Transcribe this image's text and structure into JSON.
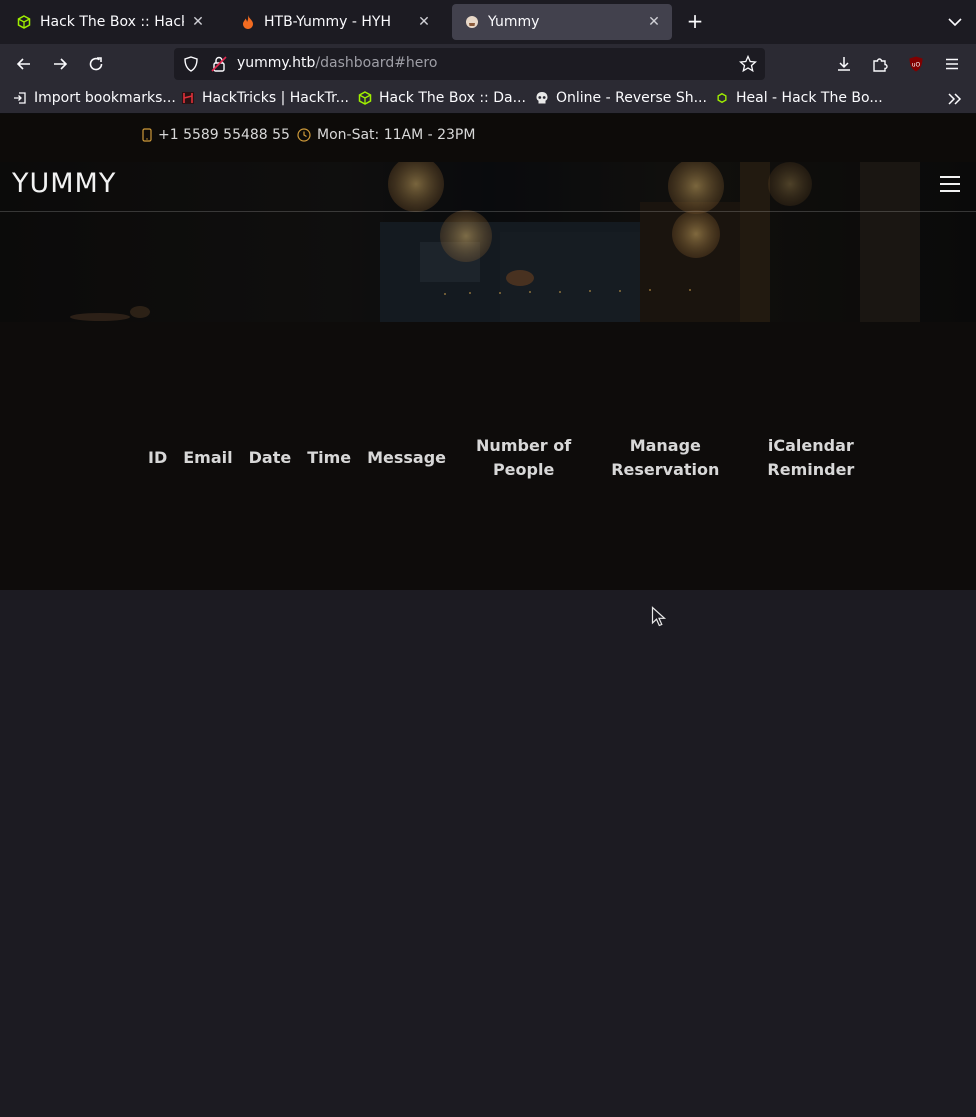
{
  "browser": {
    "tabs": [
      {
        "title": "Hack The Box :: Hack Th",
        "active": false
      },
      {
        "title": "HTB-Yummy - HYH",
        "active": false
      },
      {
        "title": "Yummy",
        "active": true
      }
    ],
    "url": {
      "host": "yummy.htb",
      "path": "/dashboard#hero"
    },
    "bookmarks": [
      {
        "label": "Import bookmarks..."
      },
      {
        "label": "HackTricks | HackTr..."
      },
      {
        "label": "Hack The Box :: Da..."
      },
      {
        "label": "Online - Reverse Sh..."
      },
      {
        "label": "Heal - Hack The Bo..."
      }
    ]
  },
  "site": {
    "phone": "+1 5589 55488 55",
    "hours": "Mon-Sat: 11AM - 23PM",
    "logo": "YUMMY"
  },
  "table": {
    "headers": [
      {
        "line1": "ID",
        "line2": ""
      },
      {
        "line1": "Email",
        "line2": ""
      },
      {
        "line1": "Date",
        "line2": ""
      },
      {
        "line1": "Time",
        "line2": ""
      },
      {
        "line1": "Message",
        "line2": ""
      },
      {
        "line1": "Number of",
        "line2": "People"
      },
      {
        "line1": "Manage",
        "line2": "Reservation"
      },
      {
        "line1": "iCalendar",
        "line2": "Reminder"
      }
    ]
  },
  "colors": {
    "accent": "#ce1212",
    "chrome_dark": "#1c1b22",
    "chrome": "#2b2a33"
  }
}
